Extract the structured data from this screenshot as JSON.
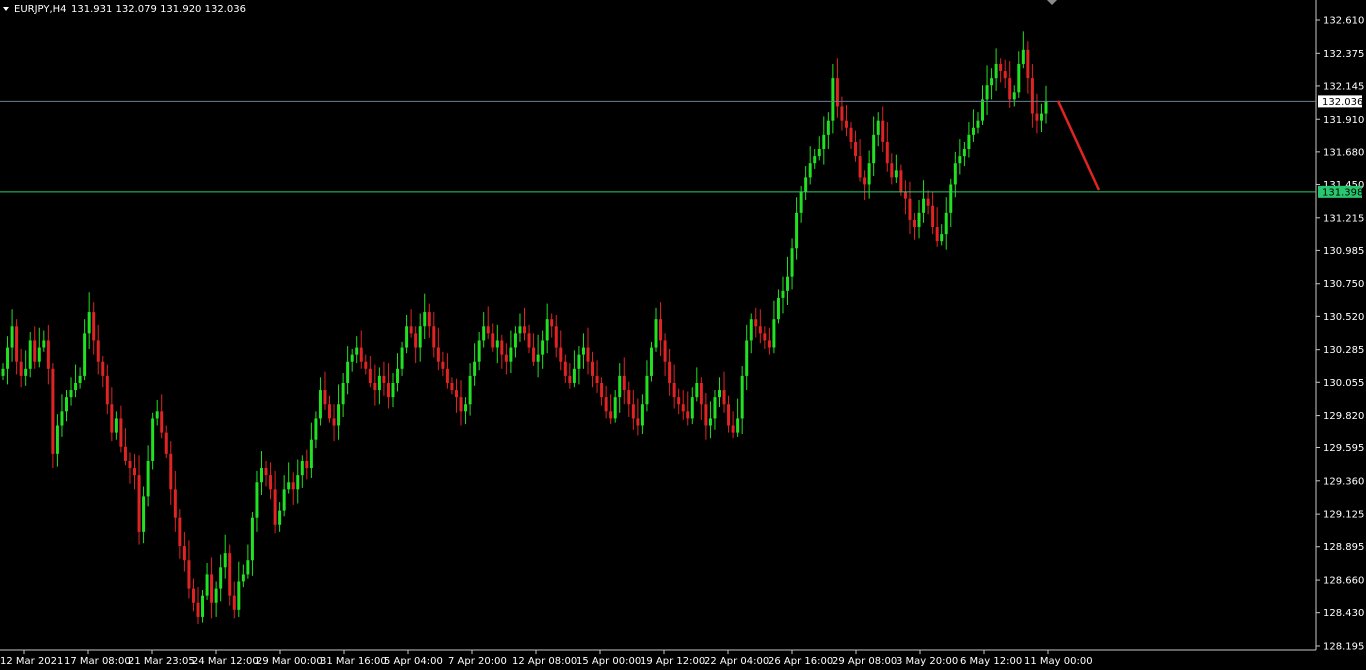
{
  "header": {
    "symbol_label": "EURJPY,H4",
    "ohlc_text": "131.931 132.079 131.920 132.036"
  },
  "colors": {
    "background": "#000000",
    "bull": "#22e022",
    "bear": "#e02424",
    "axis": "#c8c8c8",
    "price_line": "#6b7f95",
    "level_line": "#2ecc71",
    "level_tag": "#28c76f",
    "arrow": "#e02424"
  },
  "current_price": "132.036",
  "level_price": "131.398",
  "chart_data": {
    "type": "candlestick",
    "title": "",
    "ylim": [
      128.195,
      132.61
    ],
    "y_ticks": [
      "132.610",
      "132.375",
      "132.145",
      "131.910",
      "131.680",
      "131.450",
      "131.215",
      "130.985",
      "130.750",
      "130.520",
      "130.285",
      "130.055",
      "129.820",
      "129.595",
      "129.360",
      "129.125",
      "128.895",
      "128.660",
      "128.430",
      "128.195"
    ],
    "x_ticks": [
      "12 Mar 2021",
      "17 Mar 08:00",
      "21 Mar 23:05",
      "24 Mar 12:00",
      "29 Mar 00:00",
      "31 Mar 16:00",
      "5 Apr 04:00",
      "7 Apr 20:00",
      "12 Apr 08:00",
      "15 Apr 00:00",
      "19 Apr 12:00",
      "22 Apr 04:00",
      "26 Apr 16:00",
      "29 Apr 08:00",
      "3 May 20:00",
      "6 May 12:00",
      "11 May 00:00"
    ],
    "horizontal_lines": [
      {
        "price": 132.036,
        "role": "current-price"
      },
      {
        "price": 131.398,
        "role": "support-level"
      }
    ],
    "projection_arrow": {
      "from_price": 132.04,
      "to_price": 131.41,
      "direction": "down"
    },
    "closes": [
      130.15,
      130.3,
      130.45,
      130.2,
      130.1,
      130.15,
      130.35,
      130.2,
      130.3,
      130.35,
      130.15,
      129.55,
      129.75,
      129.85,
      129.95,
      130.0,
      130.05,
      130.1,
      130.4,
      130.55,
      130.35,
      130.2,
      130.1,
      129.9,
      129.7,
      129.8,
      129.6,
      129.5,
      129.45,
      129.4,
      129.0,
      129.25,
      129.5,
      129.8,
      129.85,
      129.7,
      129.55,
      129.3,
      129.1,
      128.9,
      128.8,
      128.6,
      128.5,
      128.4,
      128.55,
      128.7,
      128.5,
      128.6,
      128.75,
      128.85,
      128.55,
      128.45,
      128.65,
      128.7,
      128.8,
      129.1,
      129.35,
      129.45,
      129.4,
      129.3,
      129.05,
      129.15,
      129.3,
      129.35,
      129.3,
      129.4,
      129.5,
      129.45,
      129.65,
      129.8,
      130.0,
      129.9,
      129.8,
      129.75,
      129.9,
      130.05,
      130.2,
      130.25,
      130.3,
      130.2,
      130.15,
      130.05,
      130.0,
      130.1,
      130.05,
      129.95,
      130.05,
      130.15,
      130.3,
      130.45,
      130.4,
      130.3,
      130.45,
      130.55,
      130.45,
      130.3,
      130.2,
      130.15,
      130.05,
      130.0,
      129.95,
      129.85,
      129.9,
      130.1,
      130.2,
      130.35,
      130.45,
      130.4,
      130.3,
      130.35,
      130.25,
      130.2,
      130.3,
      130.4,
      130.45,
      130.4,
      130.3,
      130.2,
      130.25,
      130.35,
      130.5,
      130.45,
      130.3,
      130.2,
      130.1,
      130.05,
      130.15,
      130.25,
      130.3,
      130.2,
      130.1,
      130.05,
      129.95,
      129.85,
      129.8,
      129.95,
      130.1,
      130.0,
      129.9,
      129.8,
      129.75,
      129.9,
      130.1,
      130.3,
      130.5,
      130.35,
      130.2,
      130.05,
      129.95,
      129.9,
      129.85,
      129.8,
      129.95,
      130.05,
      129.9,
      129.75,
      129.8,
      129.95,
      130.0,
      129.9,
      129.75,
      129.7,
      129.8,
      130.1,
      130.35,
      130.5,
      130.45,
      130.4,
      130.35,
      130.3,
      130.5,
      130.65,
      130.7,
      130.8,
      131.0,
      131.25,
      131.4,
      131.5,
      131.6,
      131.65,
      131.7,
      131.8,
      131.9,
      132.2,
      132.0,
      131.9,
      131.85,
      131.75,
      131.65,
      131.5,
      131.45,
      131.6,
      131.8,
      131.9,
      131.75,
      131.6,
      131.5,
      131.55,
      131.4,
      131.35,
      131.2,
      131.15,
      131.25,
      131.35,
      131.3,
      131.15,
      131.05,
      131.1,
      131.25,
      131.45,
      131.6,
      131.65,
      131.7,
      131.8,
      131.85,
      131.9,
      132.05,
      132.15,
      132.2,
      132.3,
      132.25,
      132.2,
      132.05,
      132.1,
      132.3,
      132.4,
      132.2,
      131.95,
      131.9,
      131.95,
      132.036
    ]
  }
}
